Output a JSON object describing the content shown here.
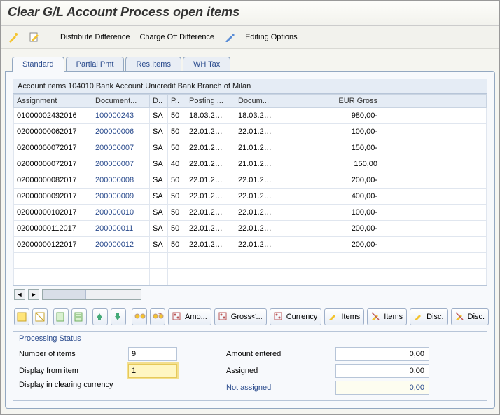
{
  "title": "Clear G/L Account Process open items",
  "toolbar": {
    "distribute": "Distribute Difference",
    "chargeoff": "Charge Off Difference",
    "editing": "Editing Options"
  },
  "tabs": [
    {
      "id": "standard",
      "label": "Standard"
    },
    {
      "id": "partial",
      "label": "Partial Pmt"
    },
    {
      "id": "res",
      "label": "Res.Items"
    },
    {
      "id": "wh",
      "label": "WH Tax"
    }
  ],
  "grid": {
    "title": "Account items 104010 Bank Account Unicredit Bank Branch of Milan",
    "headers": [
      "Assignment",
      "Document...",
      "D..",
      "P..",
      "Posting ...",
      "Docum...",
      "EUR Gross"
    ],
    "rows": [
      {
        "assignment": "01000002432016",
        "doc": "100000243",
        "d": "SA",
        "p": "50",
        "posting": "18.03.2…",
        "docdate": "18.03.2…",
        "gross": "980,00-"
      },
      {
        "assignment": "02000000062017",
        "doc": "200000006",
        "d": "SA",
        "p": "50",
        "posting": "22.01.2…",
        "docdate": "22.01.2…",
        "gross": "100,00-"
      },
      {
        "assignment": "02000000072017",
        "doc": "200000007",
        "d": "SA",
        "p": "50",
        "posting": "22.01.2…",
        "docdate": "21.01.2…",
        "gross": "150,00-"
      },
      {
        "assignment": "02000000072017",
        "doc": "200000007",
        "d": "SA",
        "p": "40",
        "posting": "22.01.2…",
        "docdate": "21.01.2…",
        "gross": "150,00"
      },
      {
        "assignment": "02000000082017",
        "doc": "200000008",
        "d": "SA",
        "p": "50",
        "posting": "22.01.2…",
        "docdate": "22.01.2…",
        "gross": "200,00-"
      },
      {
        "assignment": "02000000092017",
        "doc": "200000009",
        "d": "SA",
        "p": "50",
        "posting": "22.01.2…",
        "docdate": "22.01.2…",
        "gross": "400,00-"
      },
      {
        "assignment": "02000000102017",
        "doc": "200000010",
        "d": "SA",
        "p": "50",
        "posting": "22.01.2…",
        "docdate": "22.01.2…",
        "gross": "100,00-"
      },
      {
        "assignment": "02000000112017",
        "doc": "200000011",
        "d": "SA",
        "p": "50",
        "posting": "22.01.2…",
        "docdate": "22.01.2…",
        "gross": "200,00-"
      },
      {
        "assignment": "02000000122017",
        "doc": "200000012",
        "d": "SA",
        "p": "50",
        "posting": "22.01.2…",
        "docdate": "22.01.2…",
        "gross": "200,00-"
      }
    ]
  },
  "actions": {
    "amo": "Amo...",
    "gross": "Gross<...",
    "currency": "Currency",
    "items": "Items",
    "disc": "Disc."
  },
  "status": {
    "title": "Processing Status",
    "numItemsLabel": "Number of items",
    "numItems": "9",
    "displayFromLabel": "Display from item",
    "displayFrom": "1",
    "displayCurrLabel": "Display in clearing currency",
    "amtEnteredLabel": "Amount entered",
    "amtEntered": "0,00",
    "assignedLabel": "Assigned",
    "assigned": "0,00",
    "notAssignedLabel": "Not assigned",
    "notAssigned": "0,00"
  }
}
